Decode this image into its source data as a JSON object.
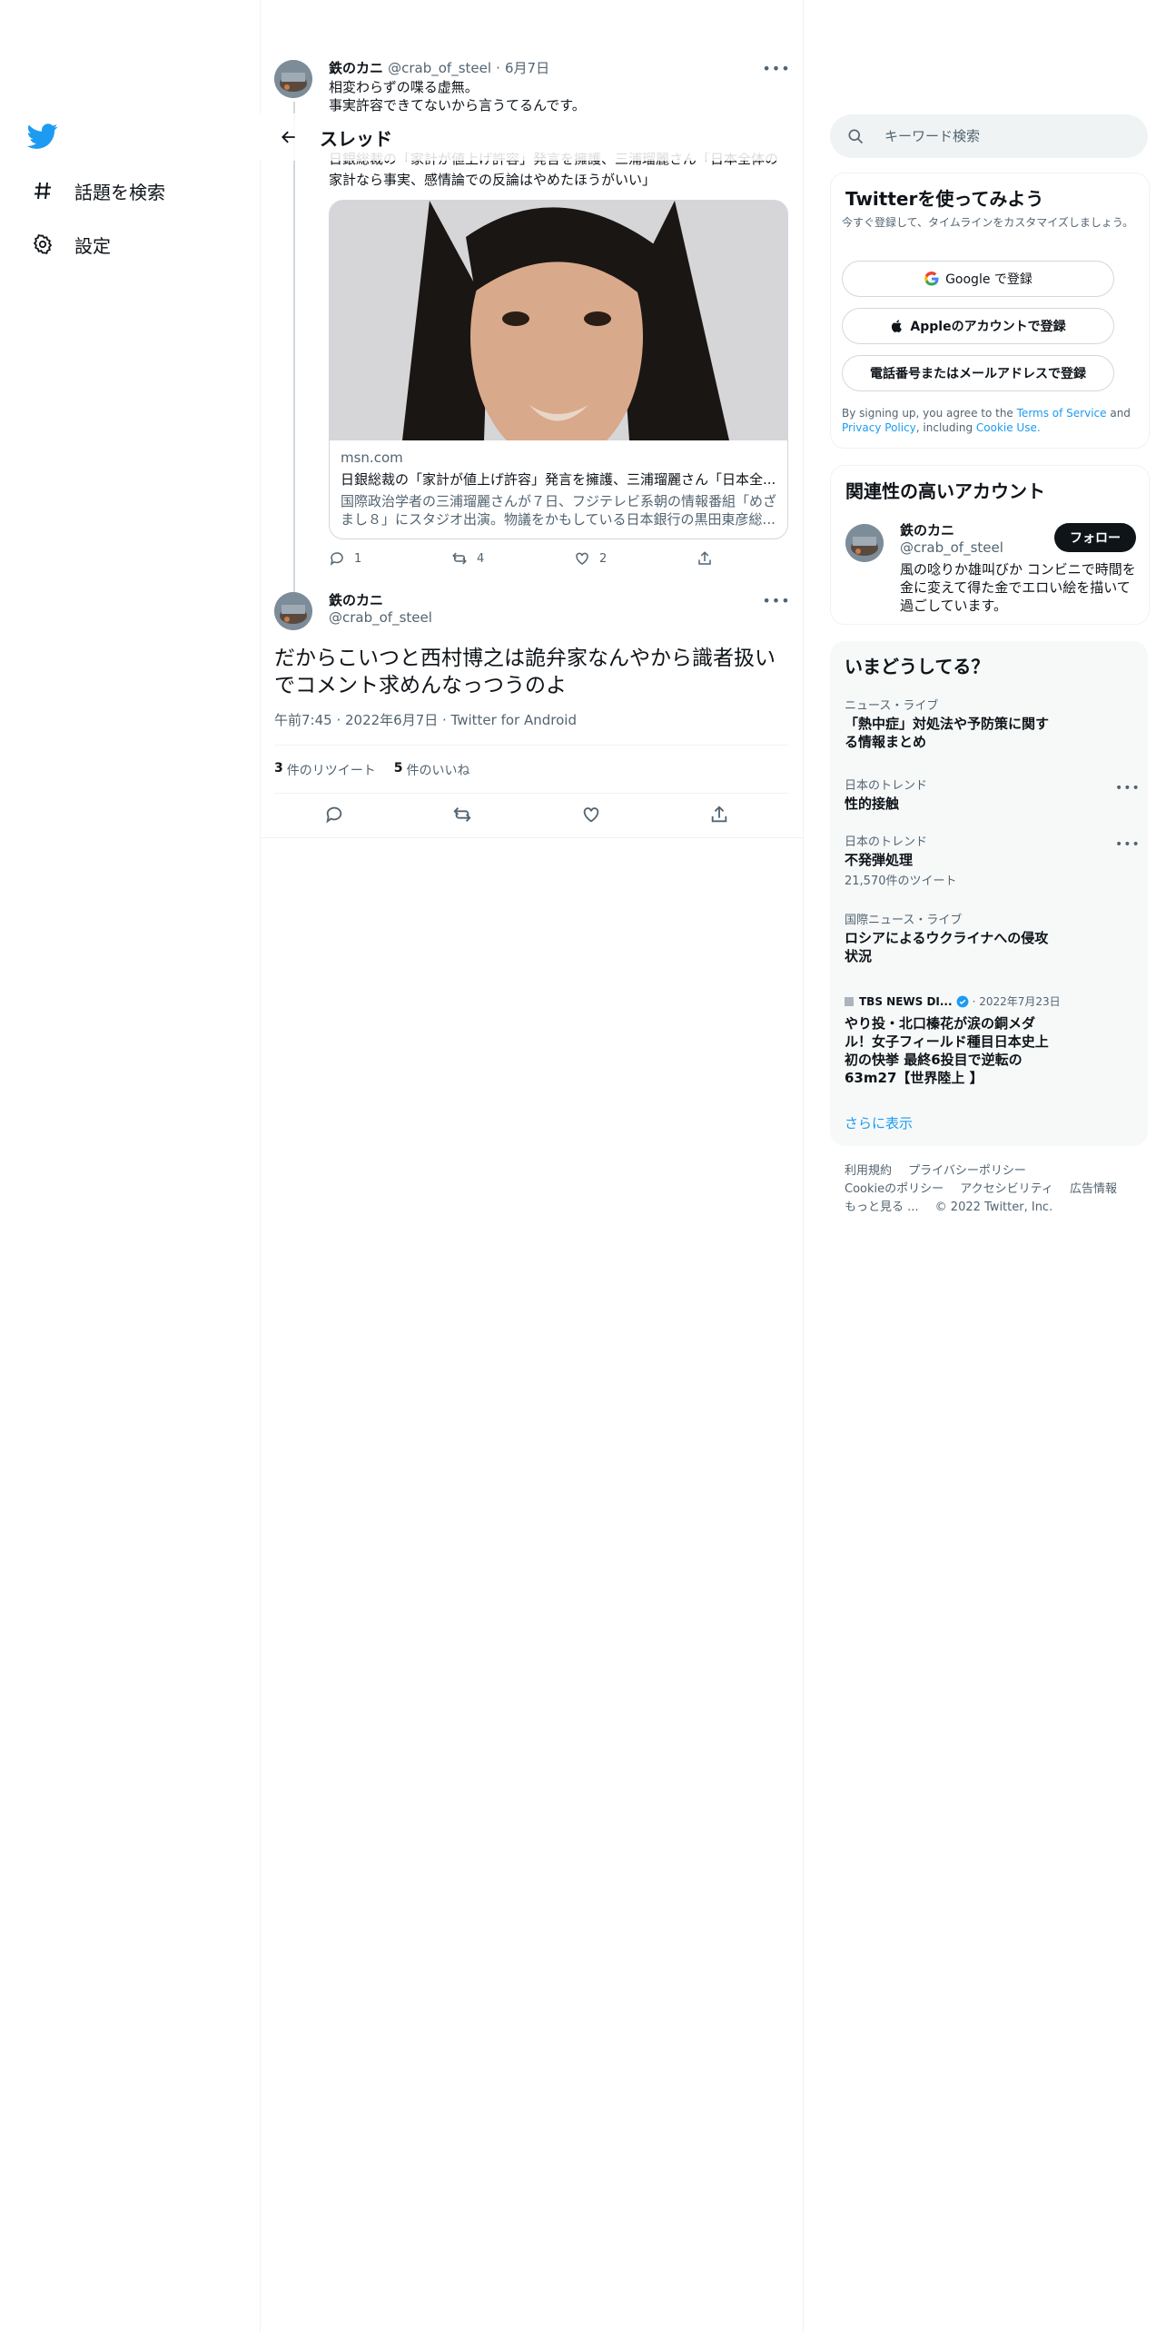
{
  "nav": {
    "items": [
      {
        "label": "話題を検索",
        "icon": "hashtag-icon"
      },
      {
        "label": "設定",
        "icon": "gear-icon"
      }
    ]
  },
  "header": {
    "title": "スレッド"
  },
  "parent_tweet": {
    "name": "鉄のカニ",
    "handle": "@crab_of_steel",
    "date": "6月7日",
    "sep": "·",
    "line1": "相変わらずの喋る虚無。",
    "line2": "事実許容できてないから言うてるんです。",
    "partial_line": "日銀総裁の「家計が値上げ許容」発言を擁護、三浦瑠麗さん「日本全体の",
    "quote_line": "家計なら事実、感情論での反論はやめたほうがいい」",
    "card": {
      "domain": "msn.com",
      "title": "日銀総裁の「家計が値上げ許容」発言を擁護、三浦瑠麗さん「日本全...",
      "description": "国際政治学者の三浦瑠麗さんが７日、フジテレビ系朝の情報番組「めざまし８」にスタジオ出演。物議をかもしている日本銀行の黒田東彦総..."
    },
    "counts": {
      "reply": "1",
      "retweet": "4",
      "like": "2"
    }
  },
  "main_tweet": {
    "name": "鉄のカニ",
    "handle": "@crab_of_steel",
    "text": "だからこいつと西村博之は詭弁家なんやから識者扱いでコメント求めんなっつうのよ",
    "timestamp": "午前7:45 · 2022年6月7日 · Twitter for Android",
    "retweets": "3",
    "retweets_label": "件のリツイート",
    "likes": "5",
    "likes_label": "件のいいね"
  },
  "search": {
    "placeholder": "キーワード検索"
  },
  "signup": {
    "title": "Twitterを使ってみよう",
    "subtitle": "今すぐ登録して、タイムラインをカスタマイズしましょう。",
    "google": "Google で登録",
    "apple": "Appleのアカウントで登録",
    "phone": "電話番号またはメールアドレスで登録",
    "terms_prefix": "By signing up, you agree to the ",
    "terms": "Terms of Service",
    "and": " and ",
    "privacy": "Privacy Policy",
    "including": ", including ",
    "cookie": "Cookie Use."
  },
  "related": {
    "title": "関連性の高いアカウント",
    "name": "鉄のカニ",
    "handle": "@crab_of_steel",
    "bio": "風の唸りか雄叫びか コンビニで時間を金に変えて得た金でエロい絵を描いて過ごしています。",
    "follow": "フォロー"
  },
  "trends": {
    "title": "いまどうしてる？",
    "items": [
      {
        "category": "ニュース・ライブ",
        "title": "「熱中症」対処法や予防策に関する情報まとめ"
      },
      {
        "category": "日本のトレンド",
        "title": "性的接触"
      },
      {
        "category": "日本のトレンド",
        "title": "不発弾処理",
        "count": "21,570件のツイート"
      },
      {
        "category": "国際ニュース・ライブ",
        "title": "ロシアによるウクライナへの侵攻状況"
      }
    ],
    "news": {
      "source": "TBS NEWS DI...",
      "date": "· 2022年7月23日",
      "title": "やり投・北口榛花が涙の銅メダル！女子フィールド種目日本史上初の快挙 最終6投目で逆転の63m27【世界陸上 】"
    },
    "show_more": "さらに表示"
  },
  "footer": {
    "links": [
      "利用規約",
      "プライバシーポリシー",
      "Cookieのポリシー",
      "アクセシビリティ",
      "広告情報",
      "もっと見る ..."
    ],
    "copyright": "© 2022 Twitter, Inc."
  },
  "colors": {
    "accent": "#1d9bf0",
    "text": "#0f1419",
    "muted": "#536471",
    "border": "#eff3f4"
  }
}
